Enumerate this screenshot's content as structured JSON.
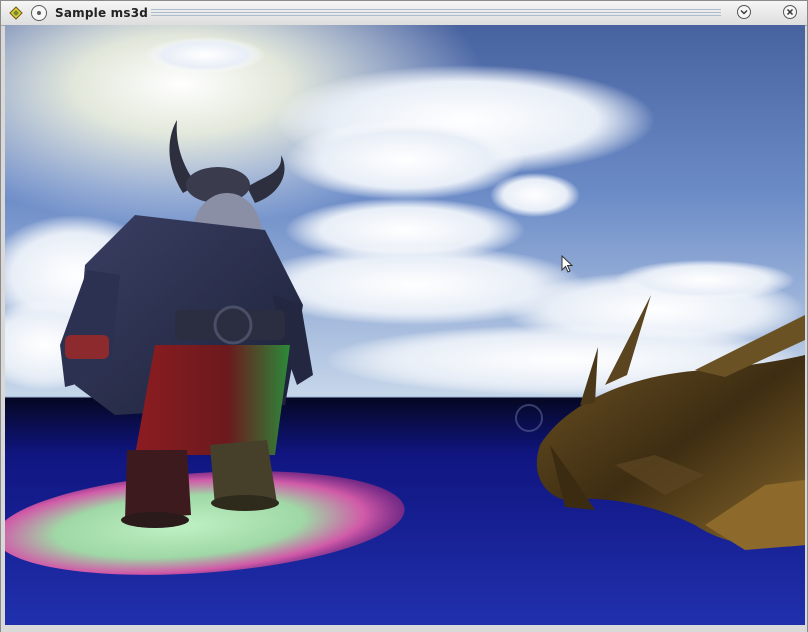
{
  "window": {
    "title": "Sample ms3d"
  },
  "icons": {
    "app": "app-diamond-icon",
    "pin": "pin-icon",
    "minimize": "chevron-down-icon",
    "close": "close-icon"
  },
  "scene": {
    "models": [
      "dwarf-model",
      "creature-model"
    ]
  },
  "colors": {
    "sky_top": "#4d6fb0",
    "floor": "#1b27a8",
    "spotlight_pink": "#d04a9e",
    "spotlight_green": "#9fe0a6"
  }
}
